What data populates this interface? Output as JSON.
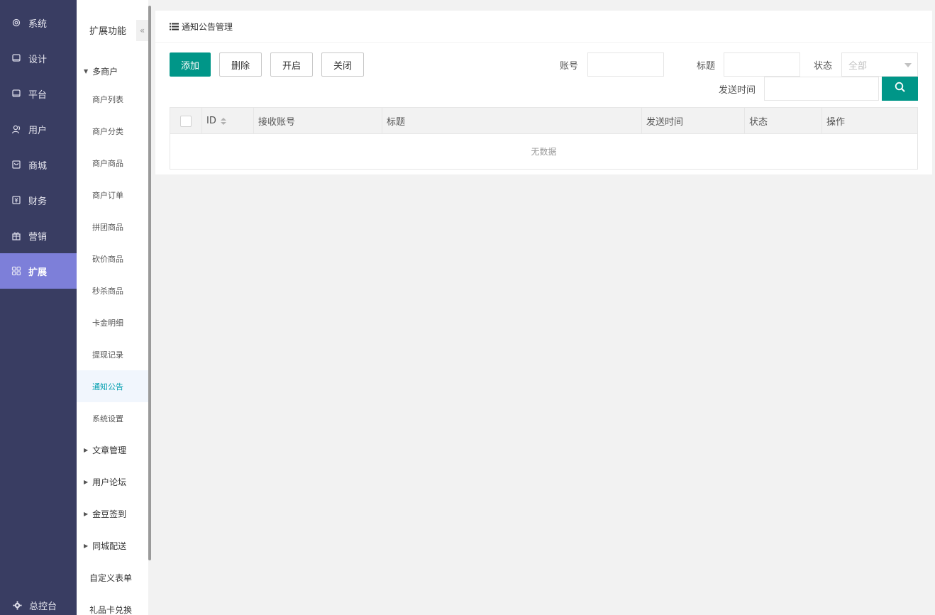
{
  "leftnav": {
    "items": [
      {
        "label": "系统",
        "icon": "gear-icon"
      },
      {
        "label": "设计",
        "icon": "monitor-icon"
      },
      {
        "label": "平台",
        "icon": "monitor-icon"
      },
      {
        "label": "用户",
        "icon": "user-icon"
      },
      {
        "label": "商城",
        "icon": "shop-icon"
      },
      {
        "label": "财务",
        "icon": "finance-icon"
      },
      {
        "label": "营销",
        "icon": "gift-icon"
      },
      {
        "label": "扩展",
        "icon": "grid-icon"
      }
    ],
    "active": "扩展",
    "bottom_label": "总控台"
  },
  "subnav": {
    "title": "扩展功能",
    "collapse_glyph": "«",
    "group_open": "多商户",
    "group_items": [
      "商户列表",
      "商户分类",
      "商户商品",
      "商户订单",
      "拼团商品",
      "砍价商品",
      "秒杀商品",
      "卡金明细",
      "提现记录",
      "通知公告",
      "系统设置"
    ],
    "active_item": "通知公告",
    "collapsed_groups": [
      "文章管理",
      "用户论坛",
      "金豆签到",
      "同城配送"
    ],
    "plain_items": [
      "自定义表单",
      "礼品卡兑换"
    ]
  },
  "panel": {
    "title": "通知公告管理"
  },
  "toolbar": {
    "add_label": "添加",
    "delete_label": "删除",
    "enable_label": "开启",
    "disable_label": "关闭"
  },
  "filters": {
    "account_label": "账号",
    "account_value": "",
    "title_label": "标题",
    "title_value": "",
    "status_label": "状态",
    "status_selected": "全部",
    "send_time_label": "发送时间",
    "send_time_value": ""
  },
  "table": {
    "columns": [
      "ID",
      "接收账号",
      "标题",
      "发送时间",
      "状态",
      "操作"
    ],
    "rows": [],
    "empty_text": "无数据"
  },
  "colors": {
    "nav_bg": "#393d62",
    "nav_active": "#7d7fd9",
    "primary": "#009688",
    "active_text": "#009faf"
  }
}
